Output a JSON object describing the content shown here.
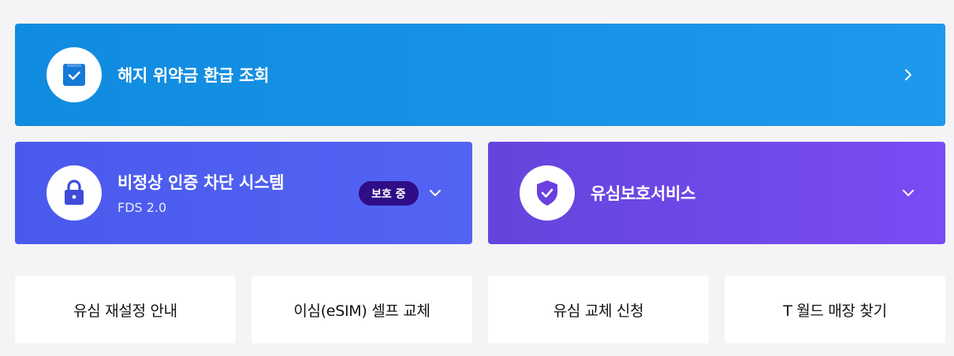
{
  "cards": {
    "refund": {
      "title": "해지 위약금 환급 조회",
      "icon": "checklist-icon",
      "color": "#1592e8"
    },
    "fds": {
      "title": "비정상 인증 차단 시스템",
      "subtitle": "FDS 2.0",
      "badge": "보호 중",
      "icon": "lock-icon",
      "color": "#4f5ef1"
    },
    "usim": {
      "title": "유심보호서비스",
      "icon": "shield-check-icon",
      "color": "#7049ec"
    }
  },
  "links": [
    {
      "label": "유심 재설정 안내"
    },
    {
      "label": "이심(eSIM) 셀프 교체"
    },
    {
      "label": "유심 교체 신청"
    },
    {
      "label": "T 월드 매장 찾기"
    }
  ]
}
